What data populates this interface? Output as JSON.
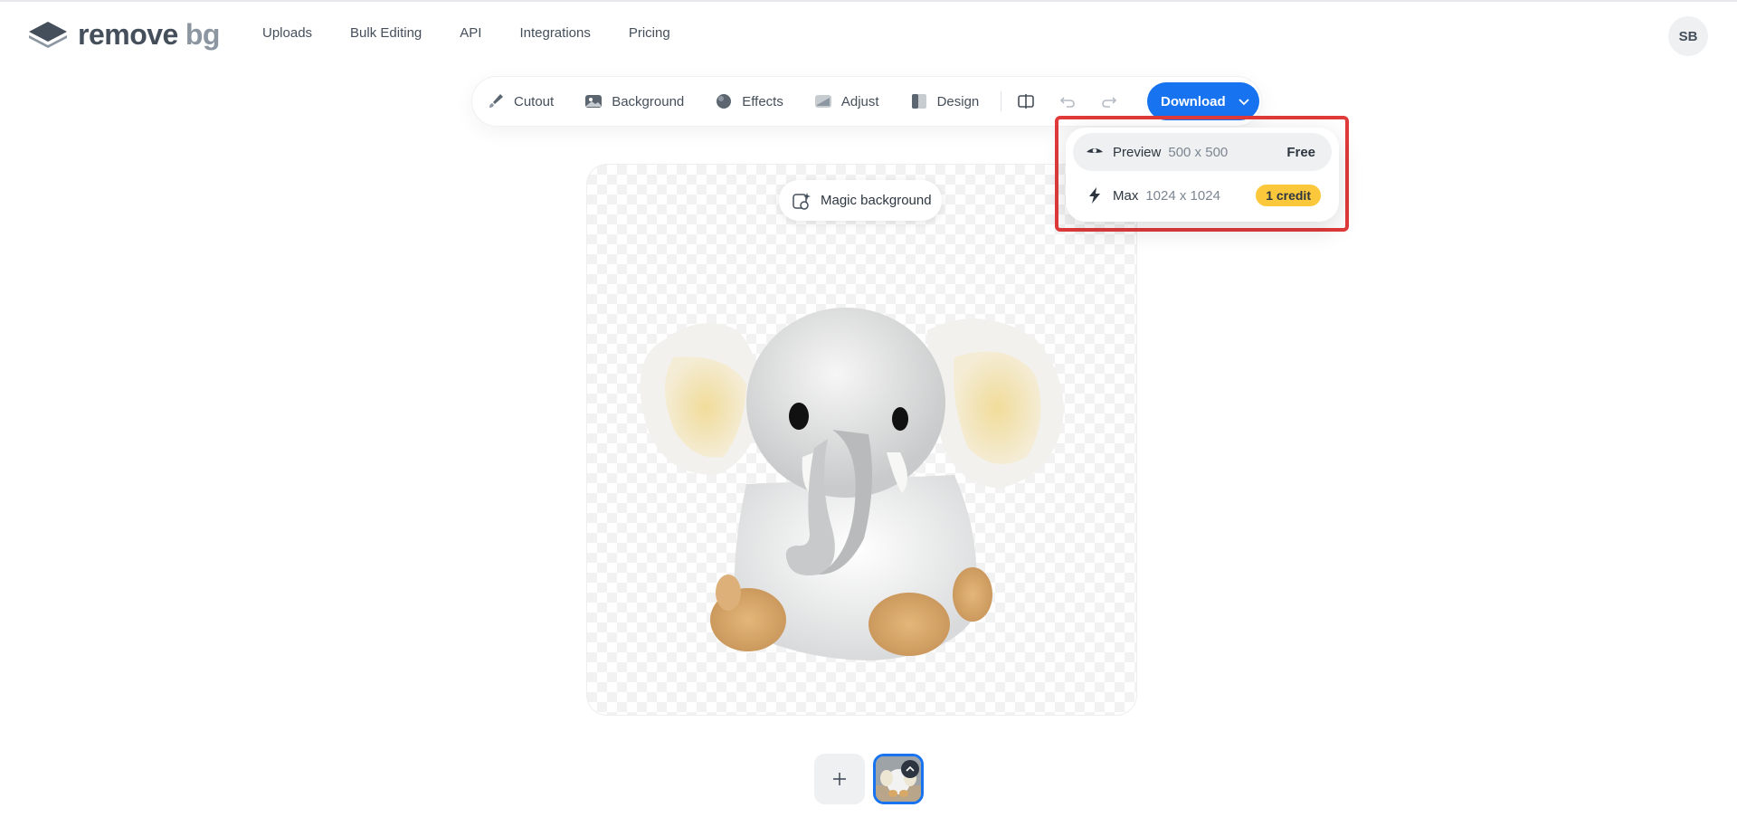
{
  "brand": {
    "name_main": "remove",
    "name_suffix": "bg"
  },
  "nav": {
    "items": [
      "Uploads",
      "Bulk Editing",
      "API",
      "Integrations",
      "Pricing"
    ]
  },
  "user": {
    "initials": "SB"
  },
  "toolbar": {
    "tools": [
      {
        "label": "Cutout",
        "icon": "brush-icon"
      },
      {
        "label": "Background",
        "icon": "image-icon"
      },
      {
        "label": "Effects",
        "icon": "effects-icon"
      },
      {
        "label": "Adjust",
        "icon": "adjust-icon"
      },
      {
        "label": "Design",
        "icon": "design-icon"
      }
    ],
    "download_label": "Download"
  },
  "download_menu": {
    "preview": {
      "name": "Preview",
      "size": "500 x 500",
      "tag": "Free",
      "icon": "eye-icon"
    },
    "max": {
      "name": "Max",
      "size": "1024 x 1024",
      "tag": "1 credit",
      "icon": "lightning-icon"
    }
  },
  "canvas": {
    "magic_background_label": "Magic background"
  },
  "colors": {
    "accent": "#1773ef",
    "credit_badge": "#fbc73b",
    "highlight_border": "#e03a3a"
  }
}
